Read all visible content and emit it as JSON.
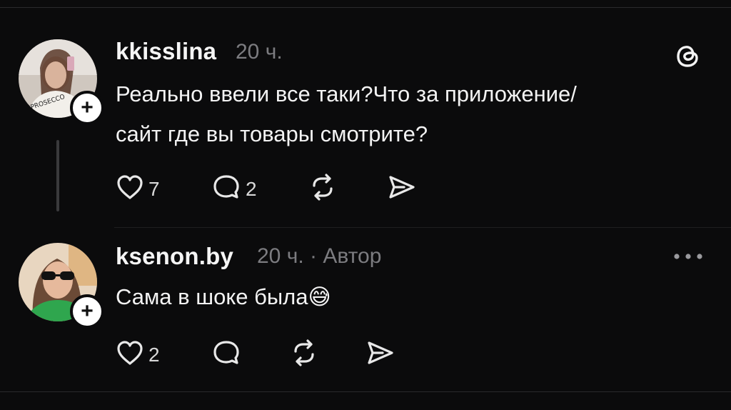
{
  "posts": [
    {
      "username": "kkisslina",
      "time": "20 ч.",
      "author_tag": "",
      "text_line1": "Реально ввели все таки?Что за приложение/",
      "text_line2": "сайт где вы товары смотрите?",
      "likes": "7",
      "replies": "2",
      "corner_icon": "threads-logo-icon"
    },
    {
      "username": "ksenon.by",
      "time": "20 ч. · Автор",
      "text": "Сама в шоке была",
      "emoji": "😅",
      "likes": "2",
      "replies": "",
      "corner_icon": "more-options-icon"
    }
  ],
  "icons": [
    "heart-icon",
    "comment-icon",
    "repost-icon",
    "share-icon",
    "plus-icon"
  ],
  "colors": {
    "background": "#0b0b0c",
    "text": "#f3f3f3",
    "muted": "#7c7c80",
    "badge": "#ffffff"
  }
}
